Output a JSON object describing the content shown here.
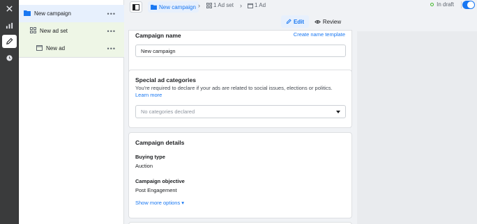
{
  "breadcrumb": {
    "campaign": "New campaign",
    "adset": "1 Ad set",
    "ad": "1 Ad"
  },
  "status": {
    "label": "In draft"
  },
  "modes": {
    "edit": "Edit",
    "review": "Review"
  },
  "tree": {
    "campaign": "New campaign",
    "adset": "New ad set",
    "ad": "New ad",
    "more": "•••"
  },
  "campaign_name_section": {
    "title": "Campaign name",
    "template_link": "Create name template",
    "value": "New campaign"
  },
  "special_ad_section": {
    "title": "Special ad categories",
    "description": "You're required to declare if your ads are related to social issues, elections or politics.",
    "learn_more": "Learn more",
    "select_placeholder": "No categories declared"
  },
  "details_section": {
    "title": "Campaign details",
    "buying_type_label": "Buying type",
    "buying_type_value": "Auction",
    "objective_label": "Campaign objective",
    "objective_value": "Post Engagement",
    "show_more": "Show more options ▾"
  },
  "colors": {
    "accent": "#1877f2",
    "campaign_highlight": "#e7f0fd",
    "adset_highlight": "#eef6e6",
    "status_dot": "#42b72a"
  }
}
